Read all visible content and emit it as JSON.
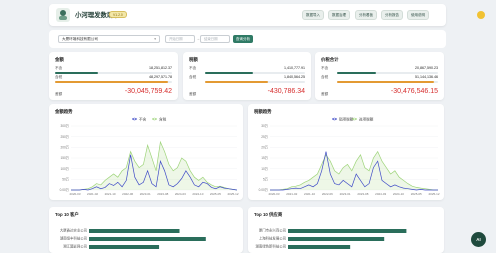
{
  "header": {
    "title": "小河理发数助手",
    "badge": "V1.2.0",
    "nav": [
      "数据导入",
      "数据治理",
      "分析看板",
      "分析报告",
      "使用说明"
    ]
  },
  "filter": {
    "company": "大厦环境科技有限公司",
    "start_placeholder": "开始日期",
    "end_placeholder": "结束日期",
    "query_button": "查询分析",
    "separator": "→"
  },
  "summary": [
    {
      "title": "金额",
      "rows": [
        {
          "label": "不含",
          "value": "18,251,812.37",
          "fraction": 0.37,
          "color": "#2a6e5b"
        },
        {
          "label": "含税",
          "value": "48,297,571.78",
          "fraction": 0.97,
          "color": "#e39a33"
        }
      ],
      "net_label": "差额",
      "net_value": "-30,045,759.42"
    },
    {
      "title": "税额",
      "rows": [
        {
          "label": "不含",
          "value": "1,410,777.91",
          "fraction": 0.48,
          "color": "#2a6e5b"
        },
        {
          "label": "含税",
          "value": "1,840,564.25",
          "fraction": 0.63,
          "color": "#e39a33"
        }
      ],
      "net_label": "差额",
      "net_value": "-430,786.34"
    },
    {
      "title": "价税合计",
      "rows": [
        {
          "label": "不含",
          "value": "20,867,590.23",
          "fraction": 0.39,
          "color": "#2a6e5b"
        },
        {
          "label": "含税",
          "value": "51,144,136.46",
          "fraction": 0.96,
          "color": "#e39a33"
        }
      ],
      "net_label": "差额",
      "net_value": "-30,476,546.15"
    }
  ],
  "trend_left": {
    "title": "金额趋势",
    "legend": [
      "不含",
      "含税"
    ],
    "y_ticks": [
      "0.00万",
      "50万",
      "100万",
      "150万",
      "200万",
      "250万",
      "300万"
    ],
    "x_ticks": [
      "2020-03",
      "2021-02",
      "2021-10",
      "2022-06",
      "2023-01",
      "2023-08",
      "2024-03",
      "2024-10",
      "2025-05",
      "2025-12"
    ]
  },
  "trend_right": {
    "title": "税额趋势",
    "legend": [
      "销项税额",
      "进项税额"
    ],
    "y_ticks": [
      "0.00万",
      "5万",
      "10万",
      "15万",
      "20万",
      "25万",
      "30万"
    ],
    "x_ticks": [
      "2020-03",
      "2021-02",
      "2021-10",
      "2022-06",
      "2023-01",
      "2023-08",
      "2024-03",
      "2024-10",
      "2025-05",
      "2025-12"
    ]
  },
  "top_customers": {
    "title": "Top 10 客户",
    "items": [
      {
        "name": "大厦鑫达实业公司",
        "fraction": 0.62
      },
      {
        "name": "湖南恒丰科技公司",
        "fraction": 0.8
      },
      {
        "name": "湘江翼影网公司",
        "fraction": 0.48
      }
    ]
  },
  "top_suppliers": {
    "title": "Top 10 供应商",
    "items": [
      {
        "name": "厦门市永兴商公司",
        "fraction": 0.8
      },
      {
        "name": "上海科技发展公司",
        "fraction": 0.65
      },
      {
        "name": "湖南绿色新科技公司",
        "fraction": 0.42
      }
    ]
  },
  "ai_button": "AI",
  "colors": {
    "primary": "#2a6e5b",
    "accent": "#e39a33",
    "negative": "#d62d2d",
    "series_blue": "#3f4bc7",
    "series_green": "#9ed47a"
  }
}
